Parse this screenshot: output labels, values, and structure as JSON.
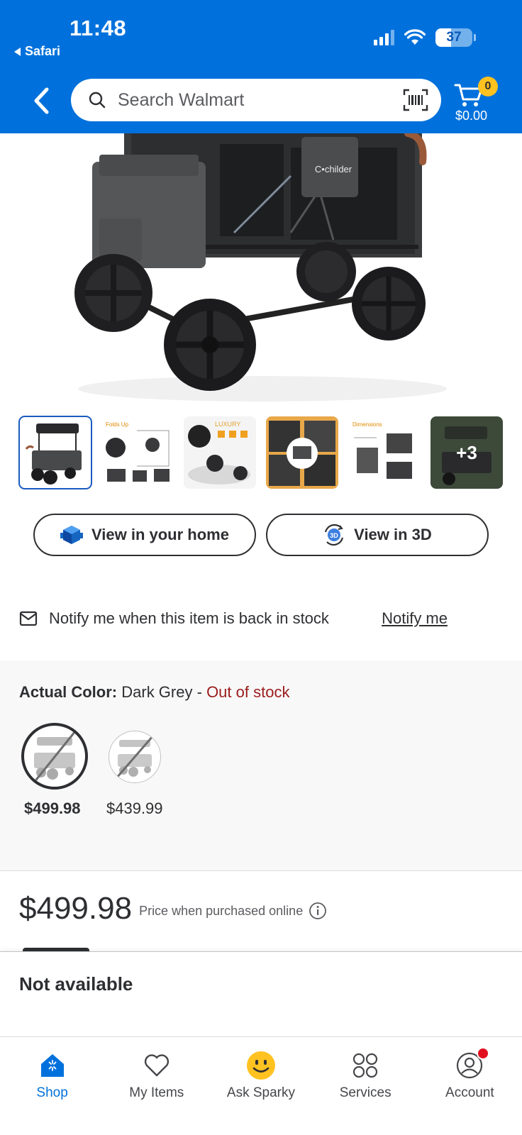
{
  "status_bar": {
    "time": "11:48",
    "back_app": "Safari",
    "battery": "37"
  },
  "header": {
    "search_placeholder": "Search Walmart",
    "cart_count": "0",
    "cart_total": "$0.00"
  },
  "gallery": {
    "hero_brand": "C•childer",
    "thumbnails": [
      {
        "name": "thumb-wagon-main",
        "caption": ""
      },
      {
        "name": "thumb-folds-up",
        "caption": "Folds Up"
      },
      {
        "name": "thumb-luxury",
        "caption": "LUXURY"
      },
      {
        "name": "thumb-features",
        "caption": ""
      },
      {
        "name": "thumb-dimensions",
        "caption": "Dimensions"
      }
    ],
    "more_count": "+3"
  },
  "actions": {
    "view_home": "View in your home",
    "view_3d": "View in 3D"
  },
  "notify": {
    "text": "Notify me when this item is back in stock",
    "link": "Notify me"
  },
  "variant": {
    "label": "Actual Color:",
    "value": "Dark Grey",
    "separator": " - ",
    "stock": "Out of stock",
    "options": [
      {
        "price": "$499.98",
        "selected": true
      },
      {
        "price": "$439.99",
        "selected": false
      }
    ]
  },
  "price": {
    "amount": "$499.98",
    "note": "Price when purchased online"
  },
  "availability": {
    "text": "Not available"
  },
  "bottom_nav": [
    {
      "label": "Shop",
      "icon": "shop-icon",
      "active": true
    },
    {
      "label": "My Items",
      "icon": "heart-icon",
      "active": false
    },
    {
      "label": "Ask Sparky",
      "icon": "sparky-icon",
      "active": false
    },
    {
      "label": "Services",
      "icon": "services-icon",
      "active": false
    },
    {
      "label": "Account",
      "icon": "account-icon",
      "active": false
    }
  ],
  "colors": {
    "brand_blue": "#0071dc",
    "spark_yellow": "#ffc220",
    "out_of_stock": "#9b1c1c",
    "text": "#2e2f32"
  }
}
